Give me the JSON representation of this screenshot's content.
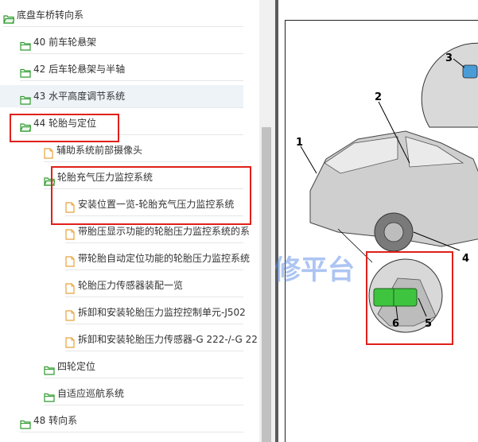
{
  "tree": {
    "items": [
      {
        "label": "底盘车桥转向系",
        "type": "folder",
        "state": "open",
        "depth": 0
      },
      {
        "label": "40 前车轮悬架",
        "type": "folder",
        "state": "closed",
        "depth": 1
      },
      {
        "label": "42 后车轮悬架与半轴",
        "type": "folder",
        "state": "closed",
        "depth": 1
      },
      {
        "label": "43 水平高度调节系统",
        "type": "folder",
        "state": "closed",
        "depth": 1,
        "selected": true
      },
      {
        "label": "44 轮胎与定位",
        "type": "folder",
        "state": "open",
        "depth": 1,
        "highlighted": true
      },
      {
        "label": "辅助系统前部摄像头",
        "type": "document",
        "depth": 2
      },
      {
        "label": "轮胎充气压力监控系统",
        "type": "folder",
        "state": "open",
        "depth": 2,
        "highlighted": true
      },
      {
        "label": "安装位置一览-轮胎充气压力监控系统",
        "type": "document",
        "depth": 3,
        "highlighted": true
      },
      {
        "label": "带胎压显示功能的轮胎压力监控系统的系",
        "type": "document",
        "depth": 3
      },
      {
        "label": "带轮胎自动定位功能的轮胎压力监控系统",
        "type": "document",
        "depth": 3
      },
      {
        "label": "轮胎压力传感器装配一览",
        "type": "document",
        "depth": 3
      },
      {
        "label": "拆卸和安装轮胎压力监控控制单元-J502",
        "type": "document",
        "depth": 3
      },
      {
        "label": "拆卸和安装轮胎压力传感器-G 222-/-G 22",
        "type": "document",
        "depth": 3
      },
      {
        "label": "四轮定位",
        "type": "folder",
        "state": "closed",
        "depth": 2
      },
      {
        "label": "自适应巡航系统",
        "type": "folder",
        "state": "closed",
        "depth": 2
      },
      {
        "label": "48 转向系",
        "type": "folder",
        "state": "closed",
        "depth": 1
      }
    ]
  },
  "diagram": {
    "callouts": [
      "1",
      "2",
      "3",
      "4",
      "5",
      "6"
    ],
    "watermark": "修平台"
  },
  "colors": {
    "highlight_red": "#e0201a",
    "folder_green": "#2e9b2e",
    "doc_orange": "#e8a23a",
    "selected_bg": "#eef3f8",
    "module_green": "#3fc43f",
    "viewer_bg": "#5b5b5b"
  }
}
